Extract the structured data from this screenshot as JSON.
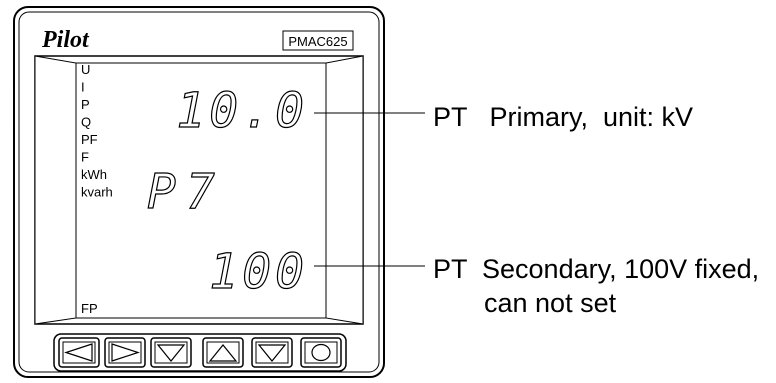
{
  "meter": {
    "brand": "Pilot",
    "model": "PMAC625",
    "indicators": [
      "U",
      "I",
      "P",
      "Q",
      "PF",
      "F",
      "kWh",
      "kvarh"
    ],
    "bottom_indicator": "FP",
    "display": {
      "row1": "10.0",
      "row2": "P7",
      "row3": "100"
    },
    "buttons": [
      {
        "name": "left-arrow-button",
        "icon": "left-arrow-icon"
      },
      {
        "name": "right-arrow-button",
        "icon": "right-arrow-icon"
      },
      {
        "name": "down-arrow-button",
        "icon": "down-arrow-icon"
      },
      {
        "name": "up-arrow-button",
        "icon": "up-arrow-icon"
      },
      {
        "name": "down-arrow-button-2",
        "icon": "down-arrow-icon"
      },
      {
        "name": "circle-button",
        "icon": "circle-icon"
      }
    ]
  },
  "annotations": {
    "top": "PT   Primary,  unit: kV",
    "bottom_line1": "PT  Secondary, 100V fixed,",
    "bottom_line2": "can not set"
  }
}
